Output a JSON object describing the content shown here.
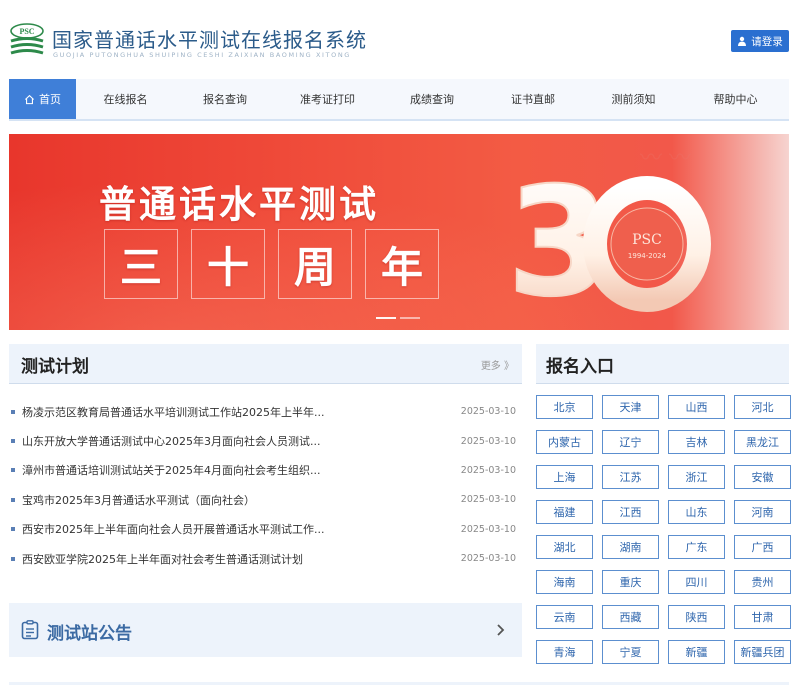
{
  "header": {
    "title": "国家普通话水平测试在线报名系统",
    "subtitle": "GUOJIA PUTONGHUA SHUIPING CESHI ZAIXIAN BAOMING XITONG",
    "logo_text": "PSC",
    "login_label": "请登录"
  },
  "nav": {
    "items": [
      {
        "label": "首页"
      },
      {
        "label": "在线报名"
      },
      {
        "label": "报名查询"
      },
      {
        "label": "准考证打印"
      },
      {
        "label": "成绩查询"
      },
      {
        "label": "证书直邮"
      },
      {
        "label": "测前须知"
      },
      {
        "label": "帮助中心"
      }
    ]
  },
  "banner": {
    "line1": "普通话水平测试",
    "line2": [
      "三",
      "十",
      "周",
      "年"
    ],
    "badge_text": "PSC",
    "badge_years": "1994-2024"
  },
  "plan": {
    "title": "测试计划",
    "more_label": "更多 》",
    "items": [
      {
        "text": "杨凌示范区教育局普通话水平培训测试工作站2025年上半年...",
        "date": "2025-03-10"
      },
      {
        "text": "山东开放大学普通话测试中心2025年3月面向社会人员测试...",
        "date": "2025-03-10"
      },
      {
        "text": "漳州市普通话培训测试站关于2025年4月面向社会考生组织...",
        "date": "2025-03-10"
      },
      {
        "text": "宝鸡市2025年3月普通话水平测试（面向社会）",
        "date": "2025-03-10"
      },
      {
        "text": "西安市2025年上半年面向社会人员开展普通话水平测试工作...",
        "date": "2025-03-10"
      },
      {
        "text": "西安欧亚学院2025年上半年面对社会考生普通话测试计划",
        "date": "2025-03-10"
      }
    ]
  },
  "notice": {
    "title": "测试站公告"
  },
  "registration": {
    "title": "报名入口",
    "regions": [
      "北京",
      "天津",
      "山西",
      "河北",
      "内蒙古",
      "辽宁",
      "吉林",
      "黑龙江",
      "上海",
      "江苏",
      "浙江",
      "安徽",
      "福建",
      "江西",
      "山东",
      "河南",
      "湖北",
      "湖南",
      "广东",
      "广西",
      "海南",
      "重庆",
      "四川",
      "贵州",
      "云南",
      "西藏",
      "陕西",
      "甘肃",
      "青海",
      "宁夏",
      "新疆",
      "新疆兵团"
    ]
  },
  "colors": {
    "primary": "#2a6fd0",
    "nav_active": "#3f7fd8",
    "banner_red": "#ee4433",
    "panel_bg": "#edf3fb",
    "region_border": "#5c8fcf"
  }
}
